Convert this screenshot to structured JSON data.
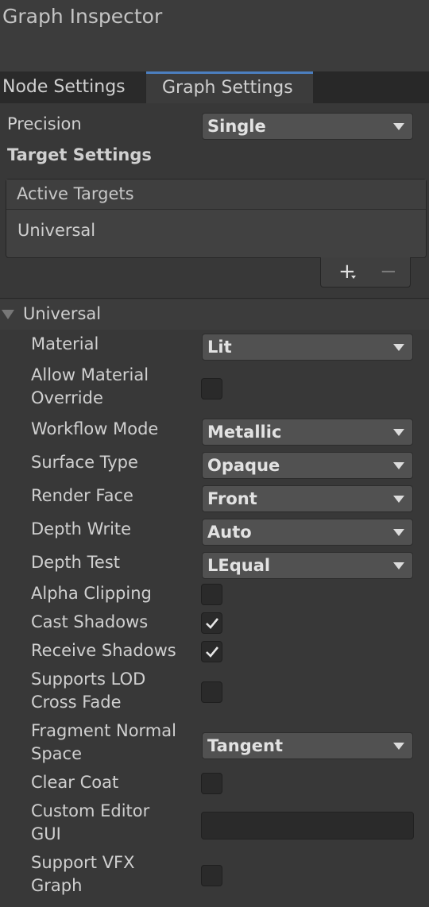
{
  "window": {
    "title": "Graph Inspector"
  },
  "tabs": [
    {
      "label": "Node Settings",
      "active": false
    },
    {
      "label": "Graph Settings",
      "active": true
    }
  ],
  "precision": {
    "label": "Precision",
    "value": "Single"
  },
  "target_settings": {
    "heading": "Target Settings",
    "active_targets_header": "Active Targets",
    "targets": [
      "Universal"
    ],
    "add_label": "+",
    "remove_label": "−"
  },
  "universal": {
    "foldout_label": "Universal",
    "material": {
      "label": "Material",
      "value": "Lit"
    },
    "allow_material_override": {
      "label_line1": "Allow Material",
      "label_line2": "Override",
      "checked": false
    },
    "workflow_mode": {
      "label": "Workflow Mode",
      "value": "Metallic"
    },
    "surface_type": {
      "label": "Surface Type",
      "value": "Opaque"
    },
    "render_face": {
      "label": "Render Face",
      "value": "Front"
    },
    "depth_write": {
      "label": "Depth Write",
      "value": "Auto"
    },
    "depth_test": {
      "label": "Depth Test",
      "value": "LEqual"
    },
    "alpha_clipping": {
      "label": "Alpha Clipping",
      "checked": false
    },
    "cast_shadows": {
      "label": "Cast Shadows",
      "checked": true
    },
    "receive_shadows": {
      "label": "Receive Shadows",
      "checked": true
    },
    "supports_lod_cross_fade": {
      "label_line1": "Supports LOD",
      "label_line2": "Cross Fade",
      "checked": false
    },
    "fragment_normal_space": {
      "label_line1": "Fragment Normal",
      "label_line2": "Space",
      "value": "Tangent"
    },
    "clear_coat": {
      "label": "Clear Coat",
      "checked": false
    },
    "custom_editor_gui": {
      "label_line1": "Custom Editor",
      "label_line2": "GUI",
      "value": ""
    },
    "support_vfx_graph": {
      "label_line1": "Support VFX",
      "label_line2": "Graph",
      "checked": false
    }
  },
  "colors": {
    "background": "#383838",
    "tab_accent": "#4c7fc0",
    "field_bg": "#515151",
    "checkbox_bg": "#2a2a2a"
  }
}
